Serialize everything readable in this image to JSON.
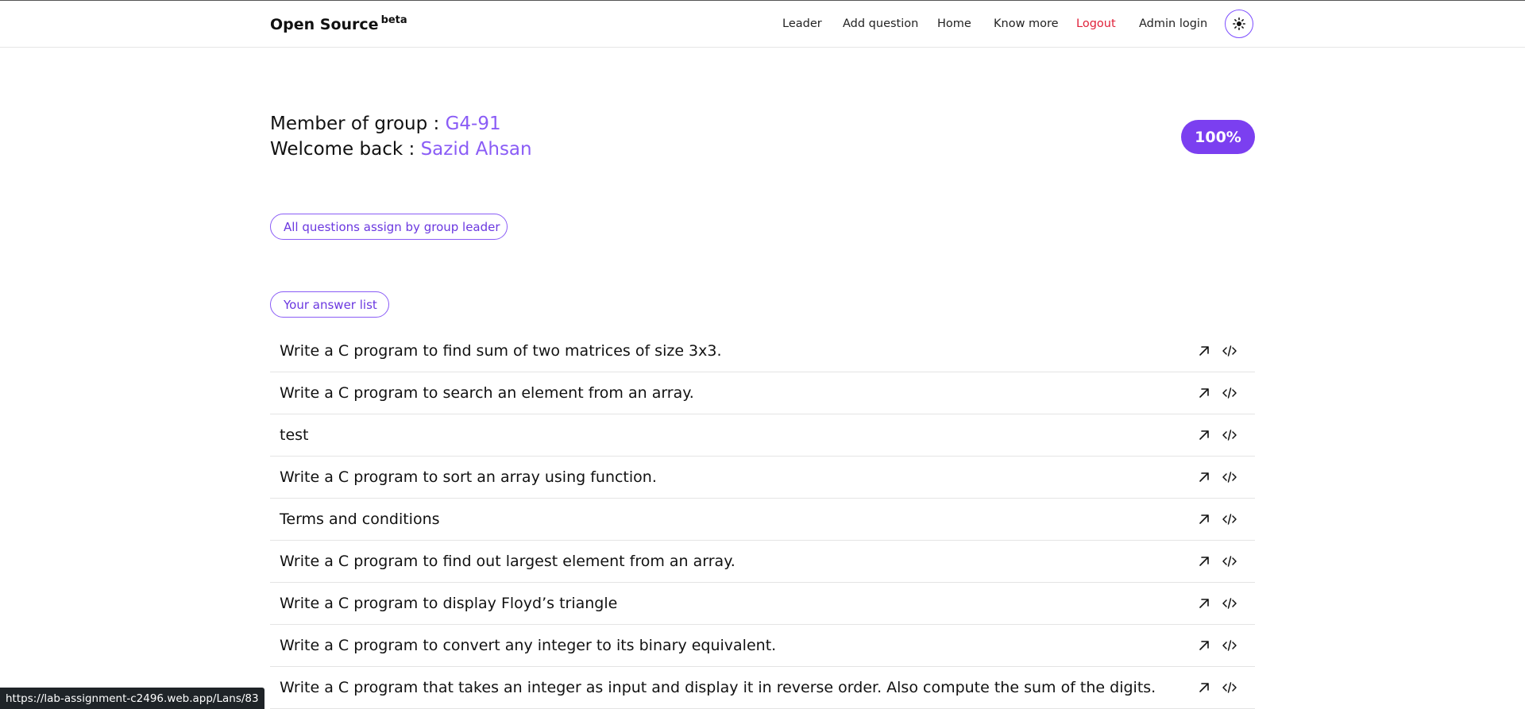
{
  "nav": {
    "brand": "Open Source",
    "brand_sup": "beta",
    "links": [
      {
        "label": "Leader"
      },
      {
        "label": "Add question"
      },
      {
        "label": "Home"
      },
      {
        "label": "Know more"
      },
      {
        "label": "Logout"
      },
      {
        "label": "Admin login"
      }
    ],
    "theme_icon": "sun-icon"
  },
  "header": {
    "group_label": "Member of group : ",
    "group_value": "G4-91",
    "welcome_label": "Welcome back : ",
    "welcome_value": "Sazid Ahsan",
    "progress": "100%"
  },
  "sections": {
    "all_questions": "All questions assign by group leader",
    "answer_list": "Your answer list"
  },
  "answers": [
    {
      "title": "Write a C program to find sum of two matrices of size 3x3."
    },
    {
      "title": "Write a C program to search an element from an array."
    },
    {
      "title": "test"
    },
    {
      "title": "Write a C program to sort an array using function."
    },
    {
      "title": "Terms and conditions"
    },
    {
      "title": "Write a C program to find out largest element from an array."
    },
    {
      "title": "Write a C program to display Floyd’s triangle"
    },
    {
      "title": "Write a C program to convert any integer to its binary equivalent."
    },
    {
      "title": "Write a C program that takes an integer as input and display it in reverse order. Also compute the sum of the digits."
    }
  ],
  "row_icons": [
    "open-link-icon",
    "code-icon"
  ],
  "status_url": "https://lab-assignment-c2496.web.app/Lans/83",
  "colors": {
    "accent": "#8a5cf6",
    "badge": "#7b3ff0",
    "logout": "#e0223a"
  }
}
